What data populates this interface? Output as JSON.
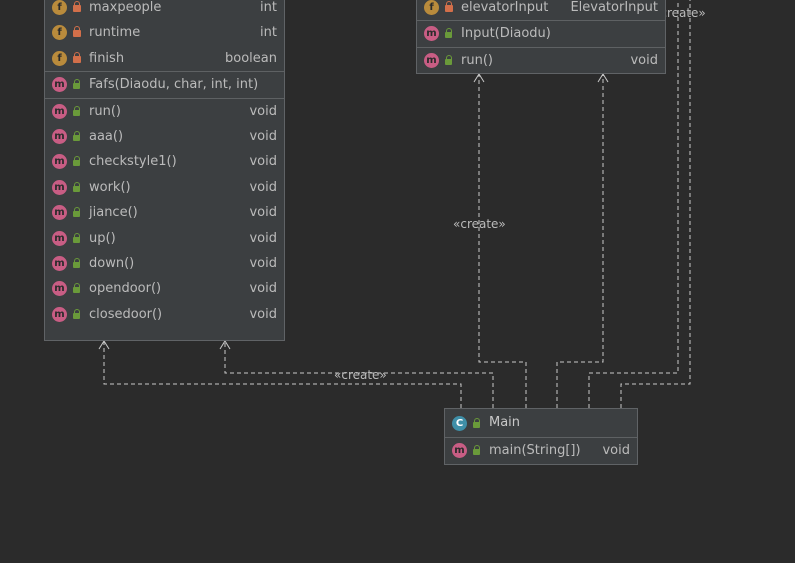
{
  "fafs_node": {
    "fields": [
      {
        "icon": "f",
        "name": "maxpeople",
        "type": "int"
      },
      {
        "icon": "f",
        "name": "runtime",
        "type": "int"
      },
      {
        "icon": "f",
        "name": "finish",
        "type": "boolean"
      }
    ],
    "constructors": [
      {
        "icon": "m",
        "name": "Fafs(Diaodu, char, int, int)",
        "type": ""
      }
    ],
    "methods": [
      {
        "icon": "m",
        "name": "run()",
        "type": "void"
      },
      {
        "icon": "m",
        "name": "aaa()",
        "type": "void"
      },
      {
        "icon": "m",
        "name": "checkstyle1()",
        "type": "void"
      },
      {
        "icon": "m",
        "name": "work()",
        "type": "void"
      },
      {
        "icon": "m",
        "name": "jiance()",
        "type": "void"
      },
      {
        "icon": "m",
        "name": "up()",
        "type": "void"
      },
      {
        "icon": "m",
        "name": "down()",
        "type": "void"
      },
      {
        "icon": "m",
        "name": "opendoor()",
        "type": "void"
      },
      {
        "icon": "m",
        "name": "closedoor()",
        "type": "void"
      }
    ]
  },
  "input_node": {
    "fields": [
      {
        "icon": "f",
        "name": "elevatorInput",
        "type": "ElevatorInput"
      }
    ],
    "constructors": [
      {
        "icon": "m",
        "name": "Input(Diaodu)",
        "type": ""
      }
    ],
    "methods": [
      {
        "icon": "m",
        "name": "run()",
        "type": "void"
      }
    ]
  },
  "main_node": {
    "title": "Main",
    "methods": [
      {
        "icon": "m",
        "name": "main(String[])",
        "type": "void"
      }
    ]
  },
  "edge_labels": {
    "create_top_right": "«create»",
    "create_middle": "«create»",
    "create_bottom": "«create»"
  },
  "colors": {
    "background": "#2b2b2b",
    "node_fill": "#3c3f41",
    "field_icon": "#b98b3c",
    "method_icon": "#c85d84",
    "class_icon": "#3f8fa8",
    "edge": "#bbbbbb"
  }
}
